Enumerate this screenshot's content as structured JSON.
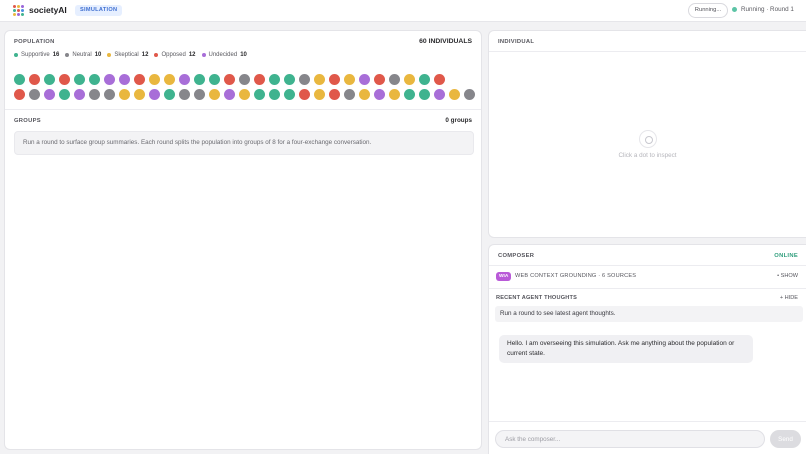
{
  "app": {
    "brand": "societyAI",
    "mode_badge": "SIMULATION",
    "logo_colors": [
      "#e0584a",
      "#e9b73f",
      "#9a66d9",
      "#3fb38f",
      "#e0584a",
      "#4a8fe0",
      "#e9b73f",
      "#9a66d9",
      "#3fb38f"
    ]
  },
  "topbar": {
    "run_button": "Running...",
    "status_text": "Running · Round 1"
  },
  "population": {
    "title": "POPULATION",
    "count": "60 INDIVIDUALS",
    "legend": [
      {
        "label": "Supportive",
        "count": "16",
        "color": "#3fb38f"
      },
      {
        "label": "Neutral",
        "count": "10",
        "color": "#86868b"
      },
      {
        "label": "Skeptical",
        "count": "12",
        "color": "#e9b73f"
      },
      {
        "label": "Opposed",
        "count": "12",
        "color": "#e0584a"
      },
      {
        "label": "Undecided",
        "count": "10",
        "color": "#a86ed8"
      }
    ],
    "dot_rows": [
      [
        "supportive",
        "opposed",
        "supportive",
        "opposed",
        "supportive",
        "supportive",
        "undecided",
        "undecided",
        "opposed",
        "skeptical",
        "skeptical",
        "undecided",
        "supportive",
        "supportive",
        "opposed",
        "neutral",
        "opposed",
        "supportive",
        "supportive",
        "neutral",
        "skeptical",
        "opposed",
        "skeptical",
        "undecided",
        "opposed",
        "neutral",
        "skeptical",
        "supportive",
        "opposed"
      ],
      [
        "opposed",
        "neutral",
        "undecided",
        "supportive",
        "undecided",
        "neutral",
        "neutral",
        "skeptical",
        "skeptical",
        "undecided",
        "supportive",
        "neutral",
        "neutral",
        "skeptical",
        "undecided",
        "skeptical",
        "supportive",
        "supportive",
        "supportive",
        "opposed",
        "skeptical",
        "opposed",
        "neutral",
        "skeptical",
        "undecided",
        "skeptical",
        "supportive",
        "supportive",
        "undecided",
        "skeptical",
        "neutral"
      ]
    ],
    "status_colors": {
      "supportive": "#3fb38f",
      "neutral": "#86868b",
      "skeptical": "#e9b73f",
      "opposed": "#e0584a",
      "undecided": "#a86ed8"
    }
  },
  "groups": {
    "title": "GROUPS",
    "count": "0 groups",
    "empty_text": "Run a round to surface group summaries. Each round splits the population into groups of 8 for a four-exchange conversation."
  },
  "individual": {
    "title": "INDIVIDUAL",
    "hint": "Click a dot to inspect"
  },
  "composer": {
    "title": "COMPOSER",
    "status": "ONLINE",
    "badge": "WIA",
    "grounding": "WEB CONTEXT GROUNDING · 6 SOURCES",
    "show_link": "• SHOW",
    "thoughts_label": "RECENT AGENT THOUGHTS",
    "hide_link": "+ HIDE",
    "thoughts_text": "Run a round to see latest agent thoughts.",
    "bot_message": "Hello. I am overseeing this simulation. Ask me anything about the population or current state.",
    "input_placeholder": "Ask the composer...",
    "input_value": "",
    "send_label": "Send"
  }
}
